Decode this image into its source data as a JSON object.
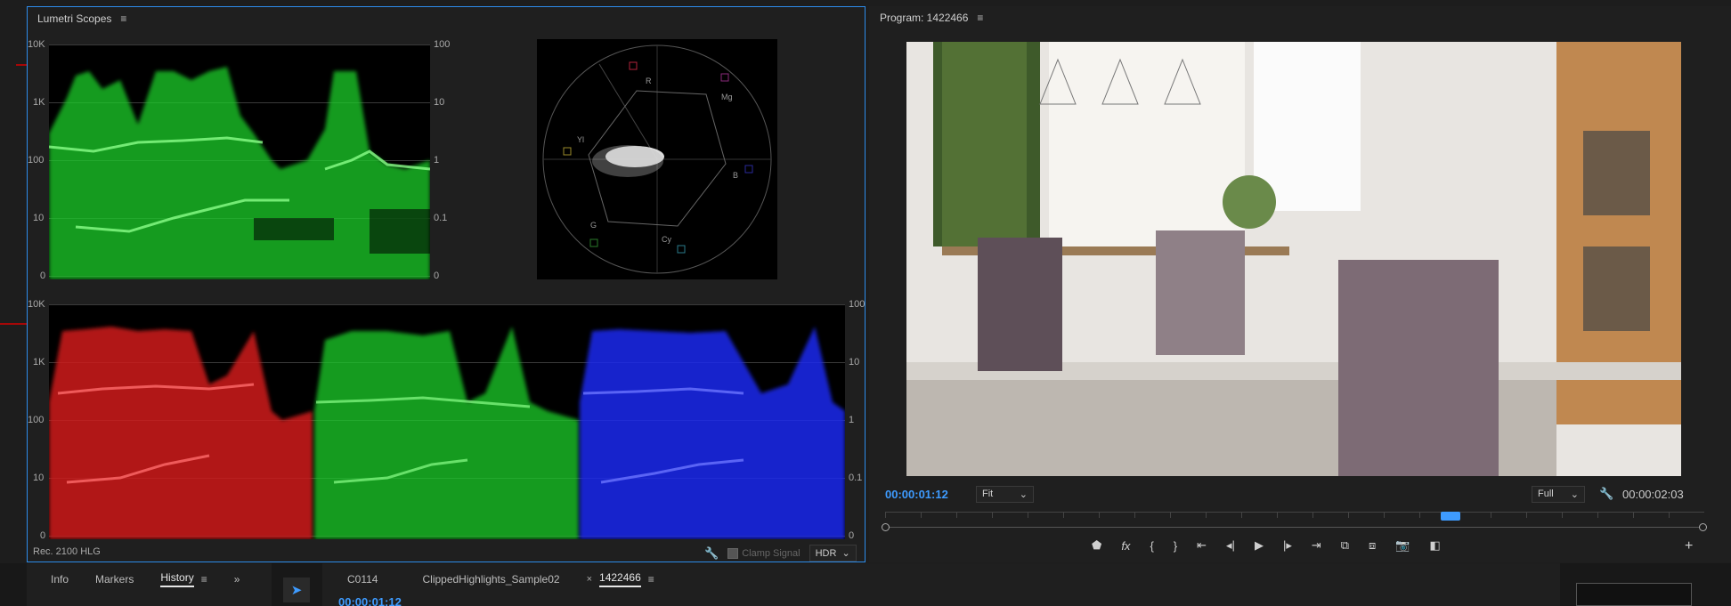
{
  "scopes": {
    "title": "Lumetri Scopes",
    "menu_icon": "hamburger-menu",
    "wave_left_labels": [
      "10K",
      "1K",
      "100",
      "10",
      "0"
    ],
    "wave_right_labels": [
      "100",
      "10",
      "1",
      "0.1",
      "0"
    ],
    "vectorscope_labels": {
      "r": "R",
      "mg": "Mg",
      "b": "B",
      "cy": "Cy",
      "g": "G",
      "yl": "Yl"
    },
    "footer_left": "Rec. 2100 HLG",
    "clamp_signal_label": "Clamp Signal",
    "hdr_label": "HDR",
    "colors": {
      "green": "#1fcf2a",
      "red": "#d01a1a",
      "blue": "#1f2cf0",
      "accent": "#2d8ceb",
      "annotation": "#d40000"
    }
  },
  "program": {
    "title": "Program: 1422466",
    "timecode_current": "00:00:01:12",
    "fit_label": "Fit",
    "full_label": "Full",
    "timecode_duration": "00:00:02:03",
    "playhead_position_fraction": 0.69
  },
  "bottom": {
    "tabs": [
      {
        "label": "Info"
      },
      {
        "label": "Markers"
      },
      {
        "label": "History"
      }
    ],
    "overflow_label": "»",
    "seq_tabs": [
      {
        "label": "C0114"
      },
      {
        "label": "ClippedHighlights_Sample02"
      },
      {
        "label": "1422466"
      }
    ],
    "close_glyph": "×",
    "timecode": "00:00:01:12"
  }
}
